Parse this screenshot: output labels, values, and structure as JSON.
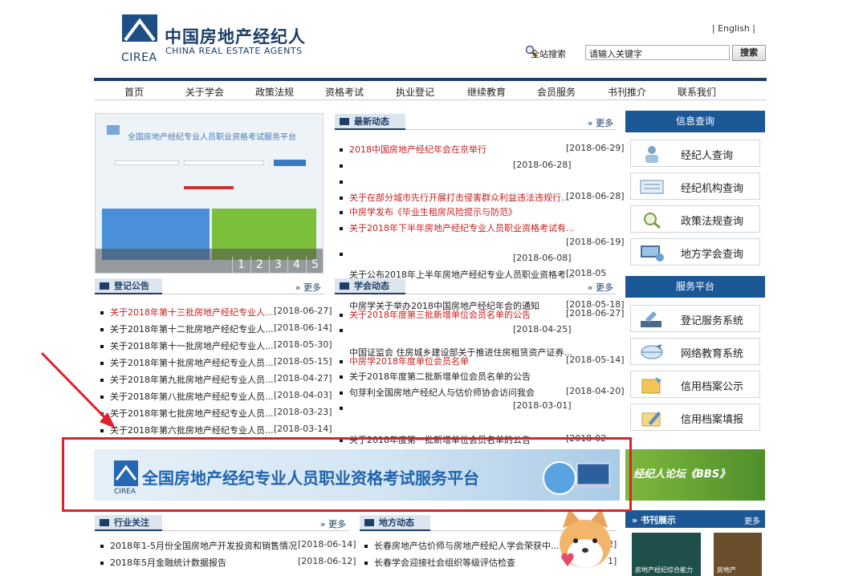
{
  "header": {
    "logo_abbr": "CIREA",
    "site_name_cn": "中国房地产经纪人",
    "site_name_en": "CHINA REAL ESTATE AGENTS",
    "english_link": "| English |",
    "search_label": "全站搜索",
    "search_value": "请输入关键字",
    "search_button": "搜索"
  },
  "nav": [
    "首页",
    "关于学会",
    "政策法规",
    "资格考试",
    "执业登记",
    "继续教育",
    "会员服务",
    "书刊推介",
    "联系我们"
  ],
  "slider": {
    "title": "全国房地产经纪专业人员职业资格考试服务平台",
    "pages": [
      "1",
      "2",
      "3",
      "4",
      "5"
    ]
  },
  "news": {
    "title": "最新动态",
    "more": "更多",
    "items": [
      {
        "text": "2018中国房地产经纪年会在京举行",
        "date": "[2018-06-29]",
        "red": true
      },
      {
        "text": "",
        "date": "[2018-06-28]",
        "red": false
      },
      {
        "text": "关于在部分城市先行开展打击侵害群众利益违法违规行...",
        "date": "[2018-06-28]",
        "red": true
      },
      {
        "text": "中房学发布《毕业生租房风险提示与防范》",
        "date": "",
        "red": true
      },
      {
        "text": "关于2018年下半年房地产经纪专业人员职业资格考试有...",
        "date": "[2018-06-19]",
        "red": true
      },
      {
        "text": "",
        "date": "[2018-06-08]",
        "red": false
      },
      {
        "text": "关于公布2018年上半年房地产经纪专业人员职业资格考...",
        "date": "[2018-05",
        "red": false
      }
    ]
  },
  "notices": {
    "title": "登记公告",
    "more": "更多",
    "items": [
      {
        "text": "关于2018年第十三批房地产经纪专业人...",
        "date": "[2018-06-27]",
        "red": true
      },
      {
        "text": "关于2018年第十二批房地产经纪专业人...",
        "date": "[2018-06-14]",
        "red": false
      },
      {
        "text": "关于2018年第十一批房地产经纪专业人...",
        "date": "[2018-05-30]",
        "red": false
      },
      {
        "text": "关于2018年第十批房地产经纪专业人员...",
        "date": "[2018-05-15]",
        "red": false
      },
      {
        "text": "关于2018年第九批房地产经纪专业人员...",
        "date": "[2018-04-27]",
        "red": false
      },
      {
        "text": "关于2018年第八批房地产经纪专业人员...",
        "date": "[2018-04-03]",
        "red": false
      },
      {
        "text": "关于2018年第七批房地产经纪专业人员...",
        "date": "[2018-03-23]",
        "red": false
      },
      {
        "text": "关于2018年第六批房地产经纪专业人员...",
        "date": "[2018-03-14]",
        "red": false
      }
    ]
  },
  "society": {
    "title": "学会动态",
    "more": "更多",
    "items": [
      {
        "text": "中房学关于举办2018中国房地产经纪年会的通知",
        "date": "[2018-05-18]",
        "red": false
      },
      {
        "text": "关于2018年度第三批新增单位会员名单的公告",
        "date": "[2018-06-27]",
        "red": true
      },
      {
        "text": "",
        "date": "[2018-04-25]",
        "red": false
      },
      {
        "text": "中国证监会 住房城乡建设部关于推进住房租赁资产证券...",
        "date": "",
        "red": false
      },
      {
        "text": "中房学2018年度单位会员名单",
        "date": "[2018-05-14]",
        "red": true
      },
      {
        "text": "关于2018年度第二批新增单位会员名单的公告",
        "date": "[2018-04-20]",
        "red": false
      },
      {
        "text": "句芽利全国房地产经纪人与估价师协会访问我会",
        "date": "",
        "red": false
      },
      {
        "text": "",
        "date": "[2018-03-01]",
        "red": false
      },
      {
        "text": "关于2018年度第一批新增单位会员名单的公告",
        "date": "[2018-02",
        "red": false
      }
    ]
  },
  "right": {
    "query_title": "信息查询",
    "query_items": [
      "经纪人查询",
      "经纪机构查询",
      "政策法规查询",
      "地方学会查询"
    ],
    "service_title": "服务平台",
    "service_items": [
      "登记服务系统",
      "网络教育系统",
      "信用档案公示",
      "信用档案填报"
    ]
  },
  "banner": {
    "title": "全国房地产经纪专业人员职业资格考试服务平台",
    "abbr": "CIREA",
    "bbs": "经纪人论坛《BBS》"
  },
  "industry": {
    "title": "行业关注",
    "more": "更多",
    "items": [
      {
        "text": "2018年1-5月份全国房地产开发投资和销售情况",
        "date": "[2018-06-14]"
      },
      {
        "text": "2018年5月金融统计数据报告",
        "date": "[2018-06-12]"
      }
    ]
  },
  "local": {
    "title": "地方动态",
    "more": "更多",
    "items": [
      {
        "text": "长春房地产估价师与房地产经纪人学会荣获中...",
        "date": "2]"
      },
      {
        "text": "长春学会迎接社会组织等级评估检查",
        "date": "1]"
      }
    ]
  },
  "books": {
    "title": "书刊展示",
    "more": "更多",
    "book1": "房地产经纪综合能力",
    "book2": "房地产"
  },
  "colors": {
    "brand": "#1d3e66",
    "accent": "#1d5896",
    "red_link": "#c81e1e",
    "highlight_box": "#e0202a"
  }
}
